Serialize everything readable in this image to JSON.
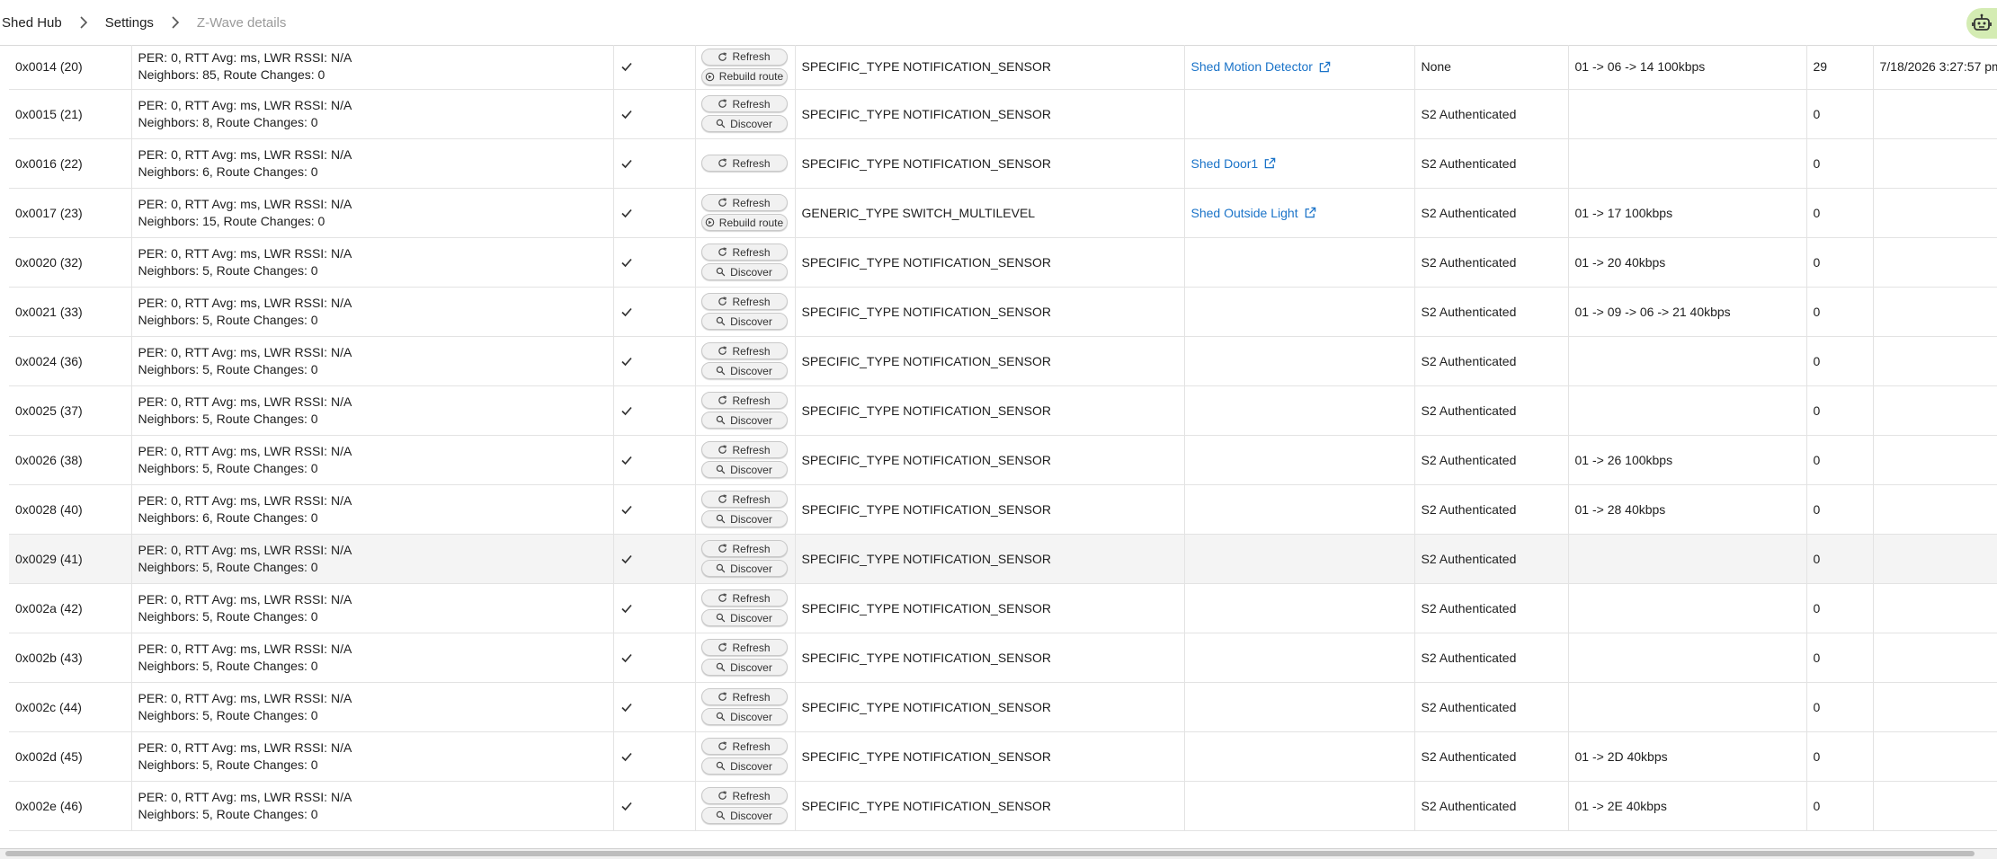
{
  "breadcrumb": {
    "items": [
      "Shed Hub",
      "Settings",
      "Z-Wave details"
    ]
  },
  "buttons": {
    "refresh": "Refresh",
    "rebuild": "Rebuild route",
    "discover": "Discover"
  },
  "colors": {
    "link": "#1a73c8",
    "avatar": "#d4ecb3",
    "hover_row": "#f4f4f4"
  },
  "rows": [
    {
      "id": "0x0014 (20)",
      "stats1": "PER: 0, RTT Avg: ms, LWR RSSI: N/A",
      "stats2": "Neighbors: 85, Route Changes: 0",
      "second_action": "rebuild",
      "type": "SPECIFIC_TYPE NOTIFICATION_SENSOR",
      "device": "Shed Motion Detector",
      "security": "None",
      "route": "01 -> 06 -> 14 100kbps",
      "count": "29",
      "last": "7/18/2026 3:27:57 pm"
    },
    {
      "id": "0x0015 (21)",
      "stats1": "PER: 0, RTT Avg: ms, LWR RSSI: N/A",
      "stats2": "Neighbors: 8, Route Changes: 0",
      "second_action": "discover",
      "type": "SPECIFIC_TYPE NOTIFICATION_SENSOR",
      "device": "",
      "security": "S2 Authenticated",
      "route": "",
      "count": "0",
      "last": ""
    },
    {
      "id": "0x0016 (22)",
      "stats1": "PER: 0, RTT Avg: ms, LWR RSSI: N/A",
      "stats2": "Neighbors: 6, Route Changes: 0",
      "second_action": "none",
      "type": "SPECIFIC_TYPE NOTIFICATION_SENSOR",
      "device": "Shed Door1",
      "security": "S2 Authenticated",
      "route": "",
      "count": "0",
      "last": ""
    },
    {
      "id": "0x0017 (23)",
      "stats1": "PER: 0, RTT Avg: ms, LWR RSSI: N/A",
      "stats2": "Neighbors: 15, Route Changes: 0",
      "second_action": "rebuild",
      "type": "GENERIC_TYPE SWITCH_MULTILEVEL",
      "device": "Shed Outside Light",
      "security": "S2 Authenticated",
      "route": "01 -> 17 100kbps",
      "count": "0",
      "last": ""
    },
    {
      "id": "0x0020 (32)",
      "stats1": "PER: 0, RTT Avg: ms, LWR RSSI: N/A",
      "stats2": "Neighbors: 5, Route Changes: 0",
      "second_action": "discover",
      "type": "SPECIFIC_TYPE NOTIFICATION_SENSOR",
      "device": "",
      "security": "S2 Authenticated",
      "route": "01 -> 20 40kbps",
      "count": "0",
      "last": ""
    },
    {
      "id": "0x0021 (33)",
      "stats1": "PER: 0, RTT Avg: ms, LWR RSSI: N/A",
      "stats2": "Neighbors: 5, Route Changes: 0",
      "second_action": "discover",
      "type": "SPECIFIC_TYPE NOTIFICATION_SENSOR",
      "device": "",
      "security": "S2 Authenticated",
      "route": "01 -> 09 -> 06 -> 21 40kbps",
      "count": "0",
      "last": ""
    },
    {
      "id": "0x0024 (36)",
      "stats1": "PER: 0, RTT Avg: ms, LWR RSSI: N/A",
      "stats2": "Neighbors: 5, Route Changes: 0",
      "second_action": "discover",
      "type": "SPECIFIC_TYPE NOTIFICATION_SENSOR",
      "device": "",
      "security": "S2 Authenticated",
      "route": "",
      "count": "0",
      "last": ""
    },
    {
      "id": "0x0025 (37)",
      "stats1": "PER: 0, RTT Avg: ms, LWR RSSI: N/A",
      "stats2": "Neighbors: 5, Route Changes: 0",
      "second_action": "discover",
      "type": "SPECIFIC_TYPE NOTIFICATION_SENSOR",
      "device": "",
      "security": "S2 Authenticated",
      "route": "",
      "count": "0",
      "last": ""
    },
    {
      "id": "0x0026 (38)",
      "stats1": "PER: 0, RTT Avg: ms, LWR RSSI: N/A",
      "stats2": "Neighbors: 5, Route Changes: 0",
      "second_action": "discover",
      "type": "SPECIFIC_TYPE NOTIFICATION_SENSOR",
      "device": "",
      "security": "S2 Authenticated",
      "route": "01 -> 26 100kbps",
      "count": "0",
      "last": ""
    },
    {
      "id": "0x0028 (40)",
      "stats1": "PER: 0, RTT Avg: ms, LWR RSSI: N/A",
      "stats2": "Neighbors: 6, Route Changes: 0",
      "second_action": "discover",
      "type": "SPECIFIC_TYPE NOTIFICATION_SENSOR",
      "device": "",
      "security": "S2 Authenticated",
      "route": "01 -> 28 40kbps",
      "count": "0",
      "last": ""
    },
    {
      "id": "0x0029 (41)",
      "stats1": "PER: 0, RTT Avg: ms, LWR RSSI: N/A",
      "stats2": "Neighbors: 5, Route Changes: 0",
      "second_action": "discover",
      "type": "SPECIFIC_TYPE NOTIFICATION_SENSOR",
      "device": "",
      "security": "S2 Authenticated",
      "route": "",
      "count": "0",
      "last": "",
      "hover": true
    },
    {
      "id": "0x002a (42)",
      "stats1": "PER: 0, RTT Avg: ms, LWR RSSI: N/A",
      "stats2": "Neighbors: 5, Route Changes: 0",
      "second_action": "discover",
      "type": "SPECIFIC_TYPE NOTIFICATION_SENSOR",
      "device": "",
      "security": "S2 Authenticated",
      "route": "",
      "count": "0",
      "last": ""
    },
    {
      "id": "0x002b (43)",
      "stats1": "PER: 0, RTT Avg: ms, LWR RSSI: N/A",
      "stats2": "Neighbors: 5, Route Changes: 0",
      "second_action": "discover",
      "type": "SPECIFIC_TYPE NOTIFICATION_SENSOR",
      "device": "",
      "security": "S2 Authenticated",
      "route": "",
      "count": "0",
      "last": ""
    },
    {
      "id": "0x002c (44)",
      "stats1": "PER: 0, RTT Avg: ms, LWR RSSI: N/A",
      "stats2": "Neighbors: 5, Route Changes: 0",
      "second_action": "discover",
      "type": "SPECIFIC_TYPE NOTIFICATION_SENSOR",
      "device": "",
      "security": "S2 Authenticated",
      "route": "",
      "count": "0",
      "last": ""
    },
    {
      "id": "0x002d (45)",
      "stats1": "PER: 0, RTT Avg: ms, LWR RSSI: N/A",
      "stats2": "Neighbors: 5, Route Changes: 0",
      "second_action": "discover",
      "type": "SPECIFIC_TYPE NOTIFICATION_SENSOR",
      "device": "",
      "security": "S2 Authenticated",
      "route": "01 -> 2D 40kbps",
      "count": "0",
      "last": ""
    },
    {
      "id": "0x002e (46)",
      "stats1": "PER: 0, RTT Avg: ms, LWR RSSI: N/A",
      "stats2": "Neighbors: 5, Route Changes: 0",
      "second_action": "discover",
      "type": "SPECIFIC_TYPE NOTIFICATION_SENSOR",
      "device": "",
      "security": "S2 Authenticated",
      "route": "01 -> 2E 40kbps",
      "count": "0",
      "last": ""
    }
  ]
}
